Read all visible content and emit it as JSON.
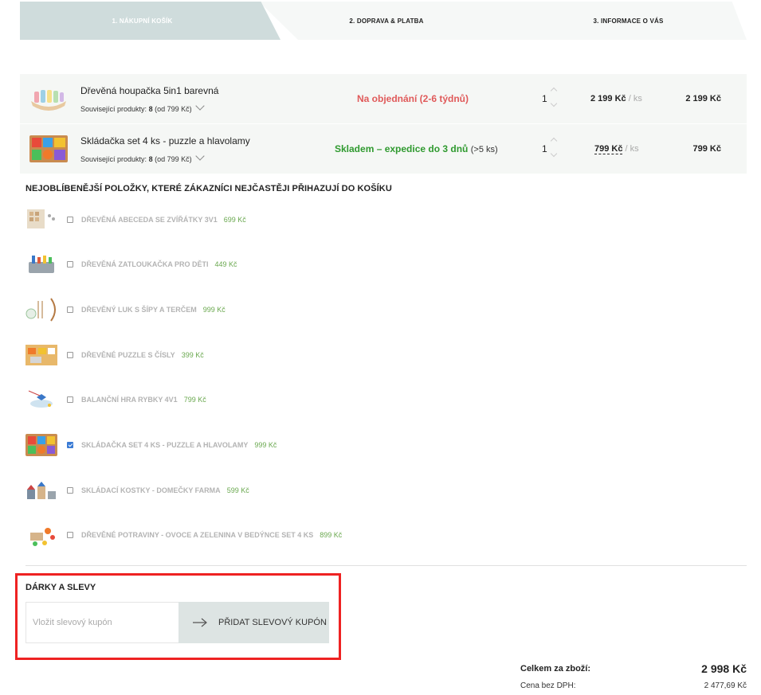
{
  "steps": [
    {
      "label": "1. NÁKUPNÍ KOŠÍK"
    },
    {
      "label": "2. DOPRAVA & PLATBA"
    },
    {
      "label": "3. INFORMACE O VÁS"
    }
  ],
  "cart": [
    {
      "name": "Dřevěná houpačka 5in1 barevná",
      "related_prefix": "Související produkty:",
      "related_count": "8",
      "related_from": "(od 799 Kč)",
      "availability": "Na objednání (2-6 týdnů)",
      "availability_sub": "",
      "qty": "1",
      "unit_price": "2 199 Kč",
      "per": "/ ks",
      "total": "2 199 Kč"
    },
    {
      "name": "Skládačka set 4 ks - puzzle a hlavolamy",
      "related_prefix": "Související produkty:",
      "related_count": "8",
      "related_from": "(od 799 Kč)",
      "availability": "Skladem – expedice do 3 dnů",
      "availability_sub": "(>5 ks)",
      "qty": "1",
      "unit_price": "799 Kč",
      "per": "/ ks",
      "total": "799 Kč"
    }
  ],
  "upsell": {
    "title": "NEJOBLÍBENĚJŠÍ POLOŽKY, KTERÉ ZÁKAZNÍCI NEJČASTĚJI PŘIHAZUJÍ DO KOŠÍKU",
    "items": [
      {
        "name": "DŘEVĚNÁ ABECEDA SE ZVÍŘÁTKY 3V1",
        "price": "699 Kč",
        "checked": false
      },
      {
        "name": "DŘEVĚNÁ ZATLOUKAČKA PRO DĚTI",
        "price": "449 Kč",
        "checked": false
      },
      {
        "name": "DŘEVĚNÝ LUK S ŠÍPY A TERČEM",
        "price": "999 Kč",
        "checked": false
      },
      {
        "name": "DŘEVĚNÉ PUZZLE S ČÍSLY",
        "price": "399 Kč",
        "checked": false
      },
      {
        "name": "BALANČNÍ HRA RYBKY 4V1",
        "price": "799 Kč",
        "checked": false
      },
      {
        "name": "SKLÁDAČKA SET 4 KS - PUZZLE A HLAVOLAMY",
        "price": "999 Kč",
        "checked": true
      },
      {
        "name": "SKLÁDACÍ KOSTKY - DOMEČKY FARMA",
        "price": "599 Kč",
        "checked": false
      },
      {
        "name": "DŘEVĚNÉ POTRAVINY - OVOCE A ZELENINA V BEDÝNCE SET 4 KS",
        "price": "899 Kč",
        "checked": false
      }
    ]
  },
  "gifts": {
    "title": "DÁRKY A SLEVY",
    "placeholder": "Vložit slevový kupón",
    "button": "PŘIDAT SLEVOVÝ KUPÓN"
  },
  "totals": {
    "sum_label": "Celkem za zboží:",
    "sum_value": "2 998 Kč",
    "net_label": "Cena bez DPH:",
    "net_value": "2 477,69 Kč"
  },
  "icons": {
    "arrow": "arrow-right-icon",
    "chevron": "chevron-down-icon"
  }
}
